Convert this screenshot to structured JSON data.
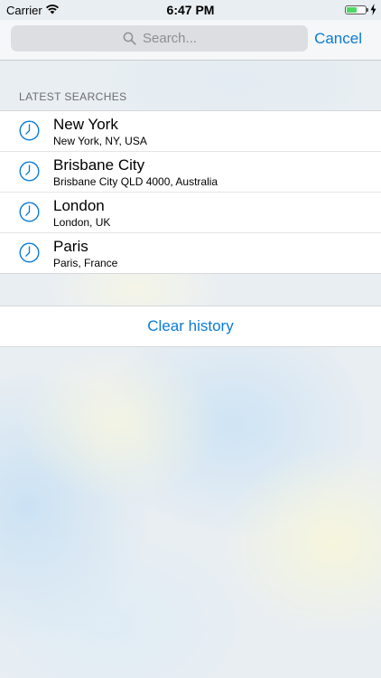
{
  "status_bar": {
    "carrier": "Carrier",
    "time": "6:47 PM",
    "battery_level": 0.55,
    "charging": true,
    "wifi_icon": "wifi-icon",
    "battery_color": "#4cd964"
  },
  "search": {
    "placeholder": "Search...",
    "icon": "search-icon",
    "cancel_label": "Cancel"
  },
  "latest_searches": {
    "header": "LATEST SEARCHES",
    "icon": "clock-icon",
    "items": [
      {
        "title": "New York",
        "subtitle": "New York, NY, USA"
      },
      {
        "title": "Brisbane City",
        "subtitle": "Brisbane City QLD 4000, Australia"
      },
      {
        "title": "London",
        "subtitle": "London, UK"
      },
      {
        "title": "Paris",
        "subtitle": "Paris, France"
      }
    ]
  },
  "clear_history_label": "Clear history",
  "colors": {
    "accent": "#0a7bd6",
    "secondary_text": "#6d6d72"
  }
}
